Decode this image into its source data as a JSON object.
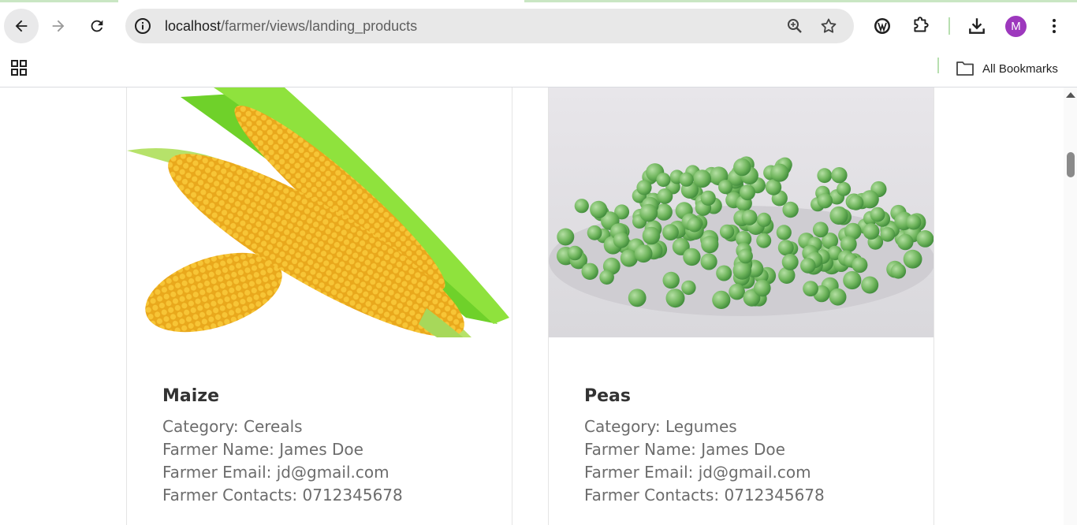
{
  "browser": {
    "url_host": "localhost",
    "url_path": "/farmer/views/landing_products",
    "avatar_letter": "M",
    "bookmarks_label": "All Bookmarks"
  },
  "products": [
    {
      "name": "Maize",
      "category": "Category: Cereals",
      "farmer_name": "Farmer Name: James Doe",
      "farmer_email": "Farmer Email: jd@gmail.com",
      "farmer_contacts": "Farmer Contacts: 0712345678",
      "image": "maize-cobs-photo"
    },
    {
      "name": "Peas",
      "category": "Category: Legumes",
      "farmer_name": "Farmer Name: James Doe",
      "farmer_email": "Farmer Email: jd@gmail.com",
      "farmer_contacts": "Farmer Contacts: 0712345678",
      "image": "green-peas-photo"
    }
  ],
  "colors": {
    "avatar": "#9d38bd",
    "omnibox": "#e8e8e8",
    "product_title": "#333333",
    "product_text": "#6c6c6c"
  }
}
